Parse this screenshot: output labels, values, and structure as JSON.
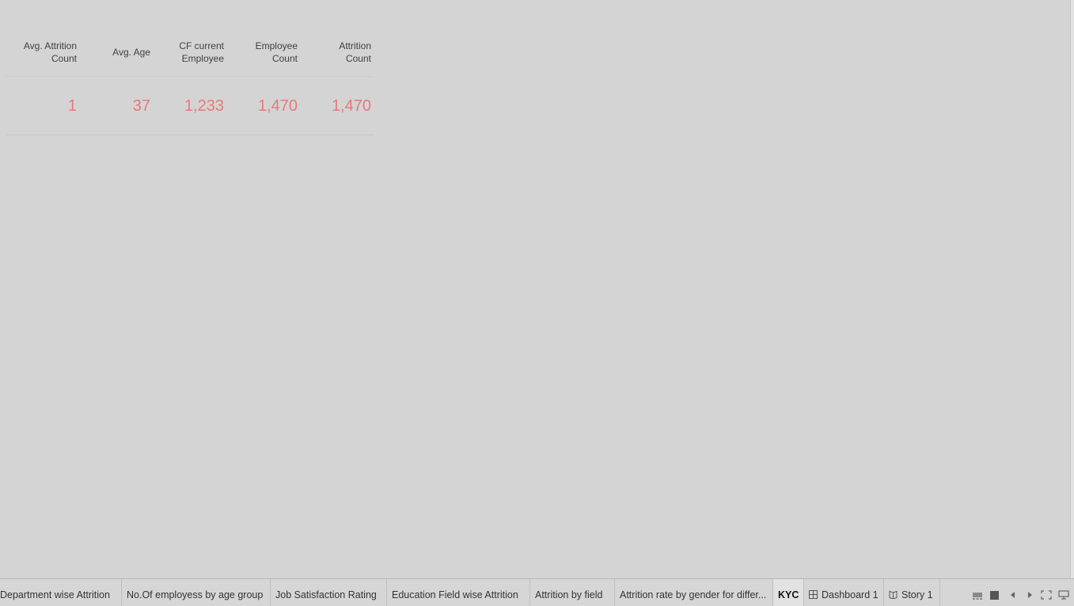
{
  "kpi_table": {
    "headers": [
      {
        "line1": "Avg. Attrition",
        "line2": "Count"
      },
      {
        "line1": "Avg. Age",
        "line2": ""
      },
      {
        "line1": "CF current",
        "line2": "Employee"
      },
      {
        "line1": "Employee",
        "line2": "Count"
      },
      {
        "line1": "Attrition",
        "line2": "Count"
      }
    ],
    "values": [
      "1",
      "37",
      "1,233",
      "1,470",
      "1,470"
    ],
    "value_color": "#e8797a"
  },
  "tabs": [
    {
      "label": "Department wise Attrition",
      "icon": "",
      "active": false
    },
    {
      "label": "No.Of employess by age group",
      "icon": "",
      "active": false
    },
    {
      "label": "Job Satisfaction Rating",
      "icon": "",
      "active": false
    },
    {
      "label": "Education Field wise Attrition",
      "icon": "",
      "active": false
    },
    {
      "label": "Attrition by field",
      "icon": "",
      "active": false
    },
    {
      "label": "Attrition rate by gender for differ...",
      "icon": "",
      "active": false
    },
    {
      "label": "KYC",
      "icon": "",
      "active": true
    },
    {
      "label": "Dashboard 1",
      "icon": "dashboard-grid-icon",
      "active": false
    },
    {
      "label": "Story 1",
      "icon": "story-book-icon",
      "active": false
    }
  ],
  "controls": [
    "filmstrip-view-icon",
    "tab-view-icon",
    "previous-sheet-icon",
    "next-sheet-icon",
    "fullscreen-icon",
    "presentation-mode-icon"
  ]
}
